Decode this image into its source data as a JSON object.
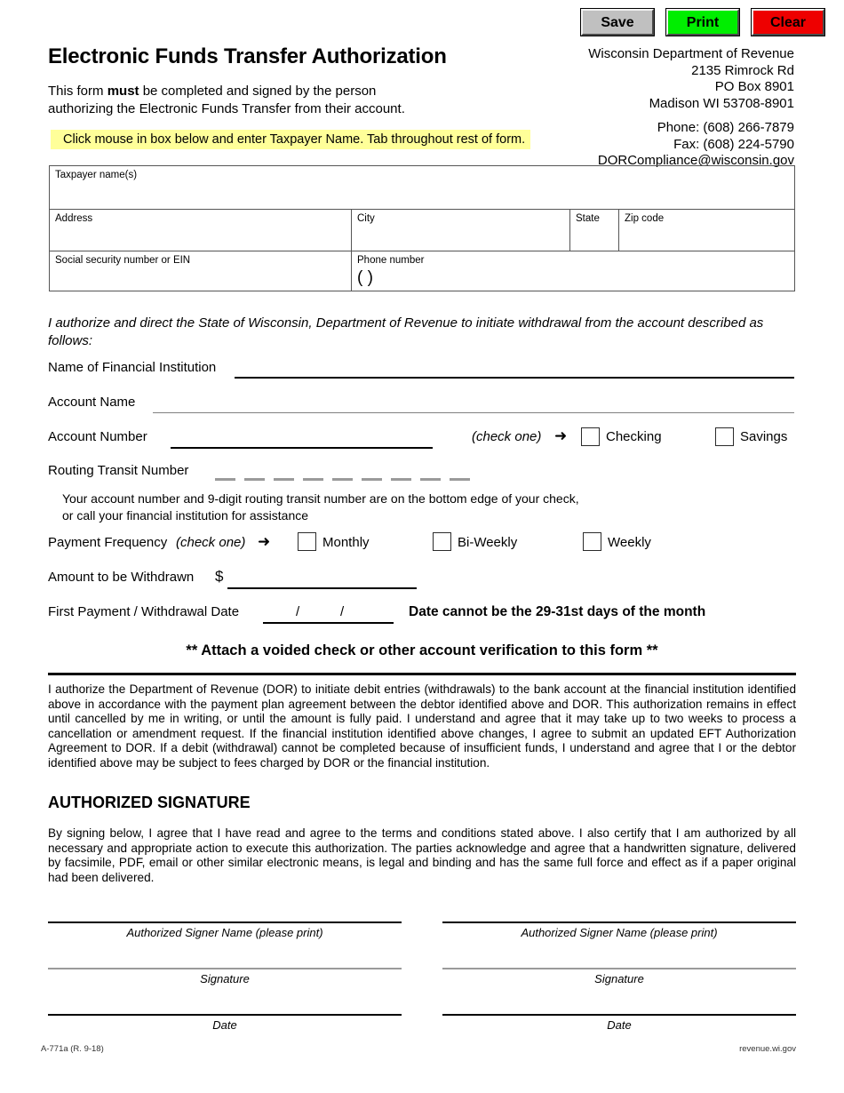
{
  "toolbar": {
    "save_label": "Save",
    "print_label": "Print",
    "clear_label": "Clear",
    "save_color": "#c0c0c0",
    "print_color": "#00ee00",
    "clear_color": "#ee0000"
  },
  "header": {
    "title": "Electronic Funds Transfer Authorization",
    "intro_line1_a": "This form ",
    "intro_line1_b": "must",
    "intro_line1_c": " be completed and signed by the person",
    "intro_line2": "authorizing the Electronic Funds Transfer from their account.",
    "agency_name": "Wisconsin Department of Revenue",
    "agency_street": "2135 Rimrock Rd",
    "agency_pobox": "PO Box 8901",
    "agency_citystatezip": "Madison WI  53708-8901",
    "phone": "Phone: (608) 266-7879",
    "fax": "Fax: (608) 224-5790",
    "email": "DORCompliance@wisconsin.gov",
    "highlight_note": "Click mouse in box below and enter Taxpayer Name.  Tab throughout rest of form.",
    "highlight_color": "#ffff99"
  },
  "taxpayer_table": {
    "taxpayer_name_label": "Taxpayer name(s)",
    "address_label": "Address",
    "city_label": "City",
    "state_label": "State",
    "zip_label": "Zip code",
    "ssn_label": "Social security number or EIN",
    "phone_label": "Phone number",
    "phone_parens": "(            )",
    "values": {
      "taxpayer_name": "",
      "address": "",
      "city": "",
      "state": "",
      "zip": "",
      "ssn": "",
      "phone": ""
    }
  },
  "authorization": {
    "statement": "I authorize and direct the State of Wisconsin, Department of Revenue to initiate withdrawal from the account described as follows:",
    "financial_institution_label": "Name of Financial Institution",
    "account_name_label": "Account Name",
    "account_number_label": "Account Number",
    "check_one_label": "(check one)",
    "arrow_glyph": "➜",
    "checking_label": "Checking",
    "savings_label": "Savings",
    "routing_label": "Routing Transit Number",
    "routing_digits": 9,
    "hint_line1": "Your account number and 9-digit routing transit number are on the bottom edge of your check,",
    "hint_line2": "or call your financial institution for assistance",
    "payment_frequency_label": "Payment Frequency",
    "frequency_options": [
      "Monthly",
      "Bi-Weekly",
      "Weekly"
    ],
    "amount_label": "Amount to be Withdrawn",
    "dollar_sign": "$",
    "first_payment_label": "First Payment / Withdrawal Date",
    "date_slash1": "/",
    "date_slash2": "/",
    "date_warning": "Date cannot be the 29-31st days of the month",
    "attach_note": "**  Attach a voided check or other account verification to this form  **",
    "values": {
      "financial_institution": "",
      "account_name": "",
      "account_number": "",
      "amount": "",
      "first_payment_date": "",
      "account_type": "",
      "payment_frequency": ""
    }
  },
  "terms": {
    "paragraph": "I authorize the Department of Revenue (DOR) to initiate debit entries (withdrawals) to the bank account at the financial institution identified above in accordance with the payment plan agreement between the debtor identified above and DOR. This authorization remains in effect until cancelled by me in writing, or until the amount is fully paid. I understand and agree that it may take up to two weeks to process a cancellation or amendment request. If the financial institution identified above changes, I agree to submit an updated EFT Authorization Agreement to DOR. If a debit (withdrawal) cannot be completed because of insufficient funds, I understand and agree that I or the debtor identified above may be subject to fees charged by DOR or the financial institution."
  },
  "signature": {
    "heading": "AUTHORIZED SIGNATURE",
    "paragraph": "By signing below, I agree that I have read and agree to the terms and conditions stated above. I also certify that I am authorized by all necessary and appropriate action to execute this authorization. The parties acknowledge and agree that a handwritten signature, delivered by facsimile, PDF, email or other similar electronic means, is legal and binding and has the same full force and effect as if a paper original had been delivered.",
    "signer_name_caption": "Authorized Signer Name (please print)",
    "signature_caption": "Signature",
    "date_caption": "Date"
  },
  "footer": {
    "form_id": "A-771a (R. 9-18)",
    "website": "revenue.wi.gov"
  }
}
